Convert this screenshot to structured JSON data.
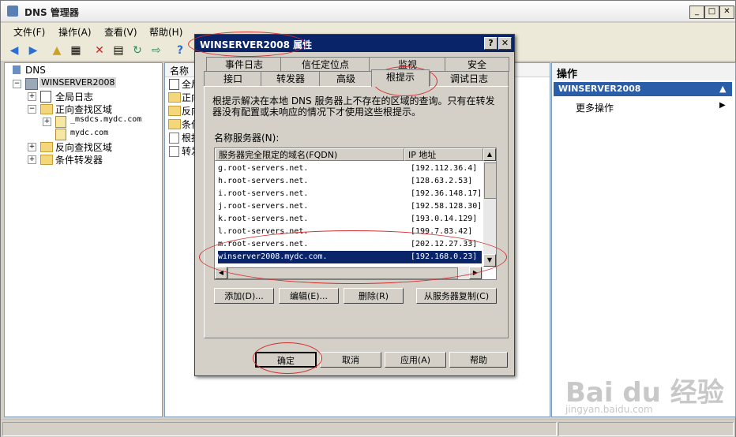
{
  "window": {
    "title": "DNS 管理器",
    "minimize": "_",
    "maximize": "□",
    "close": "✕"
  },
  "menu": [
    "文件(F)",
    "操作(A)",
    "查看(V)",
    "帮助(H)"
  ],
  "tree": {
    "root": "DNS",
    "server": "WINSERVER2008",
    "nodes": [
      "全局日志",
      "正向查找区域",
      "_msdcs.mydc.com",
      "mydc.com",
      "反向查找区域",
      "条件转发器"
    ]
  },
  "middle": {
    "header": "名称",
    "items": [
      "全局",
      "正向",
      "反向",
      "条件",
      "根提",
      "转发"
    ]
  },
  "actions": {
    "header": "操作",
    "server": "WINSERVER2008",
    "more": "更多操作"
  },
  "dialog": {
    "title": "WINSERVER2008 属性",
    "help_btn": "?",
    "close_btn": "✕",
    "tabs_row1": [
      "事件日志",
      "信任定位点",
      "监视",
      "安全"
    ],
    "tabs_row2": [
      "接口",
      "转发器",
      "高级",
      "根提示",
      "调试日志"
    ],
    "description": "根提示解决在本地 DNS 服务器上不存在的区域的查询。只有在转发器没有配置或未响应的情况下才使用这些根提示。",
    "ns_label": "名称服务器(N):",
    "columns": [
      "服务器完全限定的域名(FQDN)",
      "IP 地址"
    ],
    "rows": [
      {
        "fqdn": "g.root-servers.net.",
        "ip": "[192.112.36.4]"
      },
      {
        "fqdn": "h.root-servers.net.",
        "ip": "[128.63.2.53]"
      },
      {
        "fqdn": "i.root-servers.net.",
        "ip": "[192.36.148.17]"
      },
      {
        "fqdn": "j.root-servers.net.",
        "ip": "[192.58.128.30]"
      },
      {
        "fqdn": "k.root-servers.net.",
        "ip": "[193.0.14.129]"
      },
      {
        "fqdn": "l.root-servers.net.",
        "ip": "[199.7.83.42]"
      },
      {
        "fqdn": "m.root-servers.net.",
        "ip": "[202.12.27.33]"
      },
      {
        "fqdn": "winserver2008.mydc.com.",
        "ip": "[192.168.0.23]"
      }
    ],
    "buttons": {
      "add": "添加(D)...",
      "edit": "编辑(E)...",
      "delete": "删除(R)",
      "copy": "从服务器复制(C)"
    },
    "footer": {
      "ok": "确定",
      "cancel": "取消",
      "apply": "应用(A)",
      "help": "帮助"
    }
  },
  "watermark": {
    "main": "Bai du 经验",
    "sub": "jingyan.baidu.com"
  }
}
